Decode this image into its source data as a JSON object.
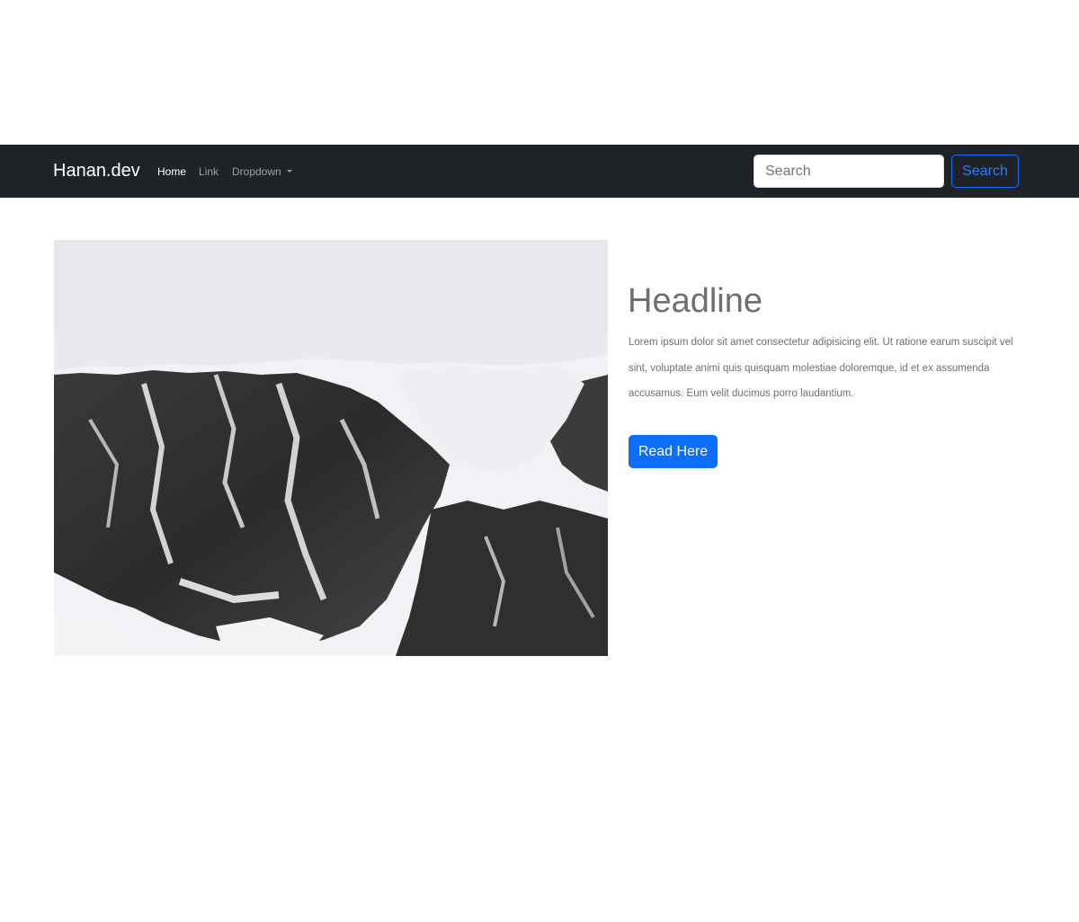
{
  "navbar": {
    "brand": "Hanan.dev",
    "links": {
      "home": "Home",
      "link": "Link",
      "dropdown": "Dropdown"
    },
    "search": {
      "placeholder": "Search",
      "button_label": "Search"
    },
    "background_color": "#1f2227"
  },
  "hero": {
    "image_icon": "snowy-mountain-photo",
    "headline": "Headline",
    "body": "Lorem ipsum dolor sit amet consectetur adipisicing elit. Ut ratione earum suscipit vel sint, voluptate animi quis quisquam molestiae doloremque, id et ex assumenda accusamus. Eum velit ducimus porro laudantium.",
    "button_label": "Read Here",
    "accent_color": "#0d6efd"
  }
}
